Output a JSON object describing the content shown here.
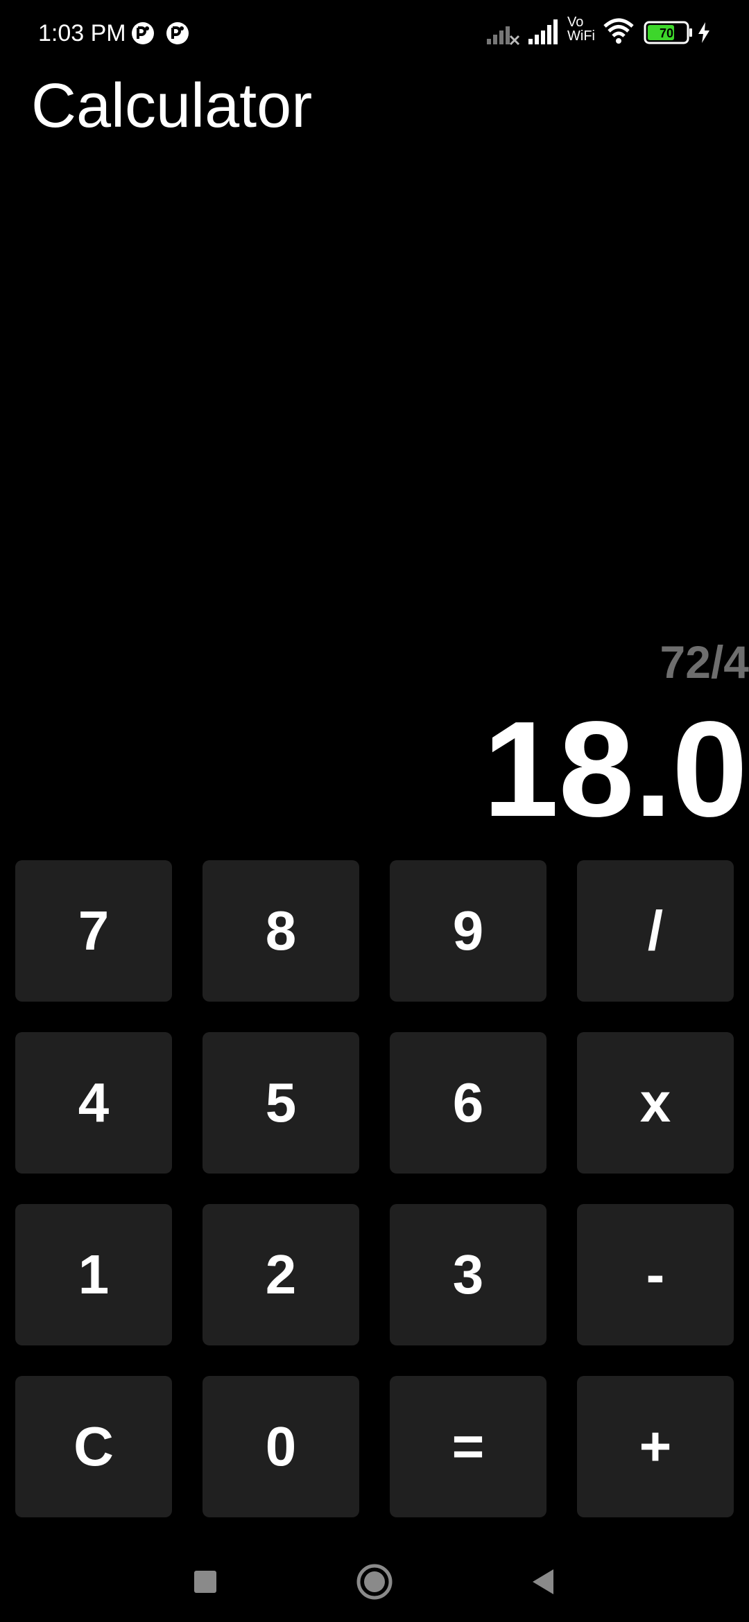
{
  "status_bar": {
    "time": "1:03 PM",
    "notification_icons": [
      "sync-icon",
      "sync-icon"
    ],
    "icons": [
      "signal-off-icon",
      "signal-icon",
      "vowifi-icon",
      "wifi-icon",
      "battery-icon",
      "charging-icon"
    ],
    "vowifi_top": "Vo",
    "vowifi_bottom": "WiFi",
    "battery_level": "70",
    "battery_color": "#3dd62b"
  },
  "app": {
    "title": "Calculator"
  },
  "display": {
    "expression": "72/4",
    "result": "18.0",
    "expression_color": "#6e6e6e"
  },
  "keypad": {
    "key_color": "#202020",
    "keys": [
      {
        "label": "7",
        "name": "key-7"
      },
      {
        "label": "8",
        "name": "key-8"
      },
      {
        "label": "9",
        "name": "key-9"
      },
      {
        "label": "/",
        "name": "key-divide"
      },
      {
        "label": "4",
        "name": "key-4"
      },
      {
        "label": "5",
        "name": "key-5"
      },
      {
        "label": "6",
        "name": "key-6"
      },
      {
        "label": "x",
        "name": "key-multiply"
      },
      {
        "label": "1",
        "name": "key-1"
      },
      {
        "label": "2",
        "name": "key-2"
      },
      {
        "label": "3",
        "name": "key-3"
      },
      {
        "label": "-",
        "name": "key-subtract"
      },
      {
        "label": "C",
        "name": "key-clear"
      },
      {
        "label": "0",
        "name": "key-0"
      },
      {
        "label": "=",
        "name": "key-equals"
      },
      {
        "label": "+",
        "name": "key-add"
      }
    ]
  },
  "nav_bar": {
    "buttons": [
      "recents-icon",
      "home-icon",
      "back-icon"
    ]
  }
}
